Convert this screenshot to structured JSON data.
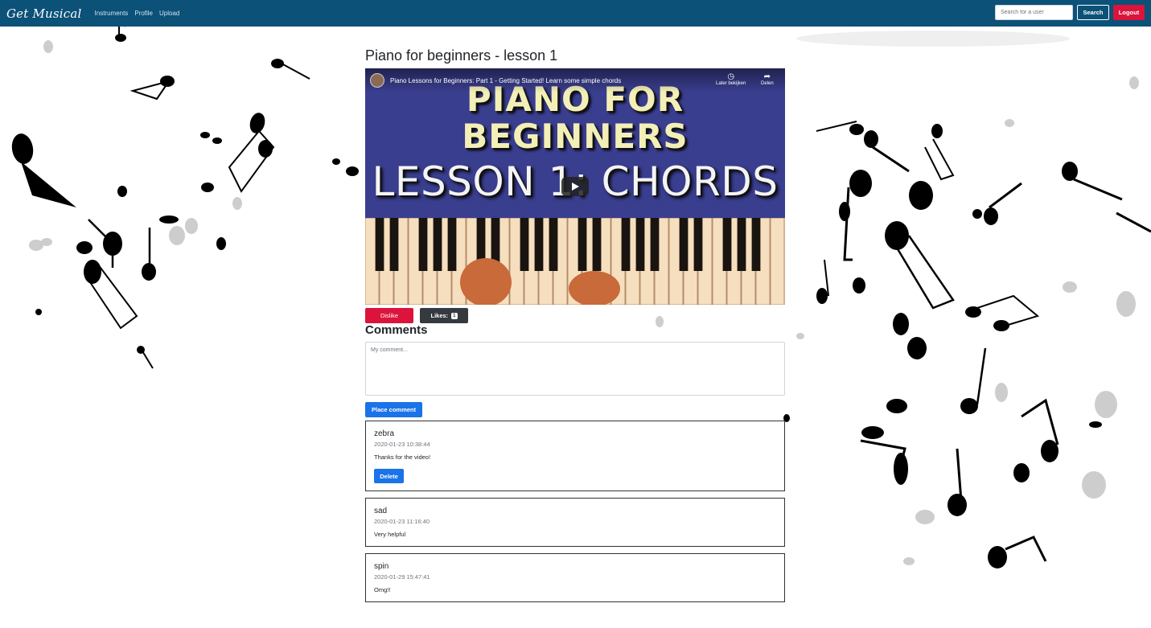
{
  "nav": {
    "brand": "Get Musical",
    "links": [
      "Instruments",
      "Profile",
      "Upload"
    ],
    "search_placeholder": "Search for a user",
    "search_label": "Search",
    "logout_label": "Logout"
  },
  "lesson": {
    "title": "Piano for beginners - lesson 1",
    "video": {
      "title": "Piano Lessons for Beginners: Part 1 - Getting Started! Learn some simple chords",
      "watch_later": "Later bekijken",
      "share": "Delen",
      "thumb_line1": "PIANO FOR",
      "thumb_line2": "BEGINNERS",
      "thumb_line3": "LESSON 1: CHORDS"
    },
    "dislike_label": "Dislike",
    "likes_label": "Likes:",
    "likes_count": "1"
  },
  "comments": {
    "heading": "Comments",
    "placeholder": "My comment...",
    "place_label": "Place comment",
    "delete_label": "Delete",
    "items": [
      {
        "user": "zebra",
        "time": "2020-01-23 10:38:44",
        "text": "Thanks for the video!"
      },
      {
        "user": "sad",
        "time": "2020-01-23 11:16:40",
        "text": "Very helpful"
      },
      {
        "user": "spin",
        "time": "2020-01-29 15:47:41",
        "text": "Omg!!"
      }
    ]
  },
  "colors": {
    "navbar": "#0b5178",
    "danger": "#dc143c",
    "primary": "#1a73e8",
    "dark": "#343a40"
  }
}
